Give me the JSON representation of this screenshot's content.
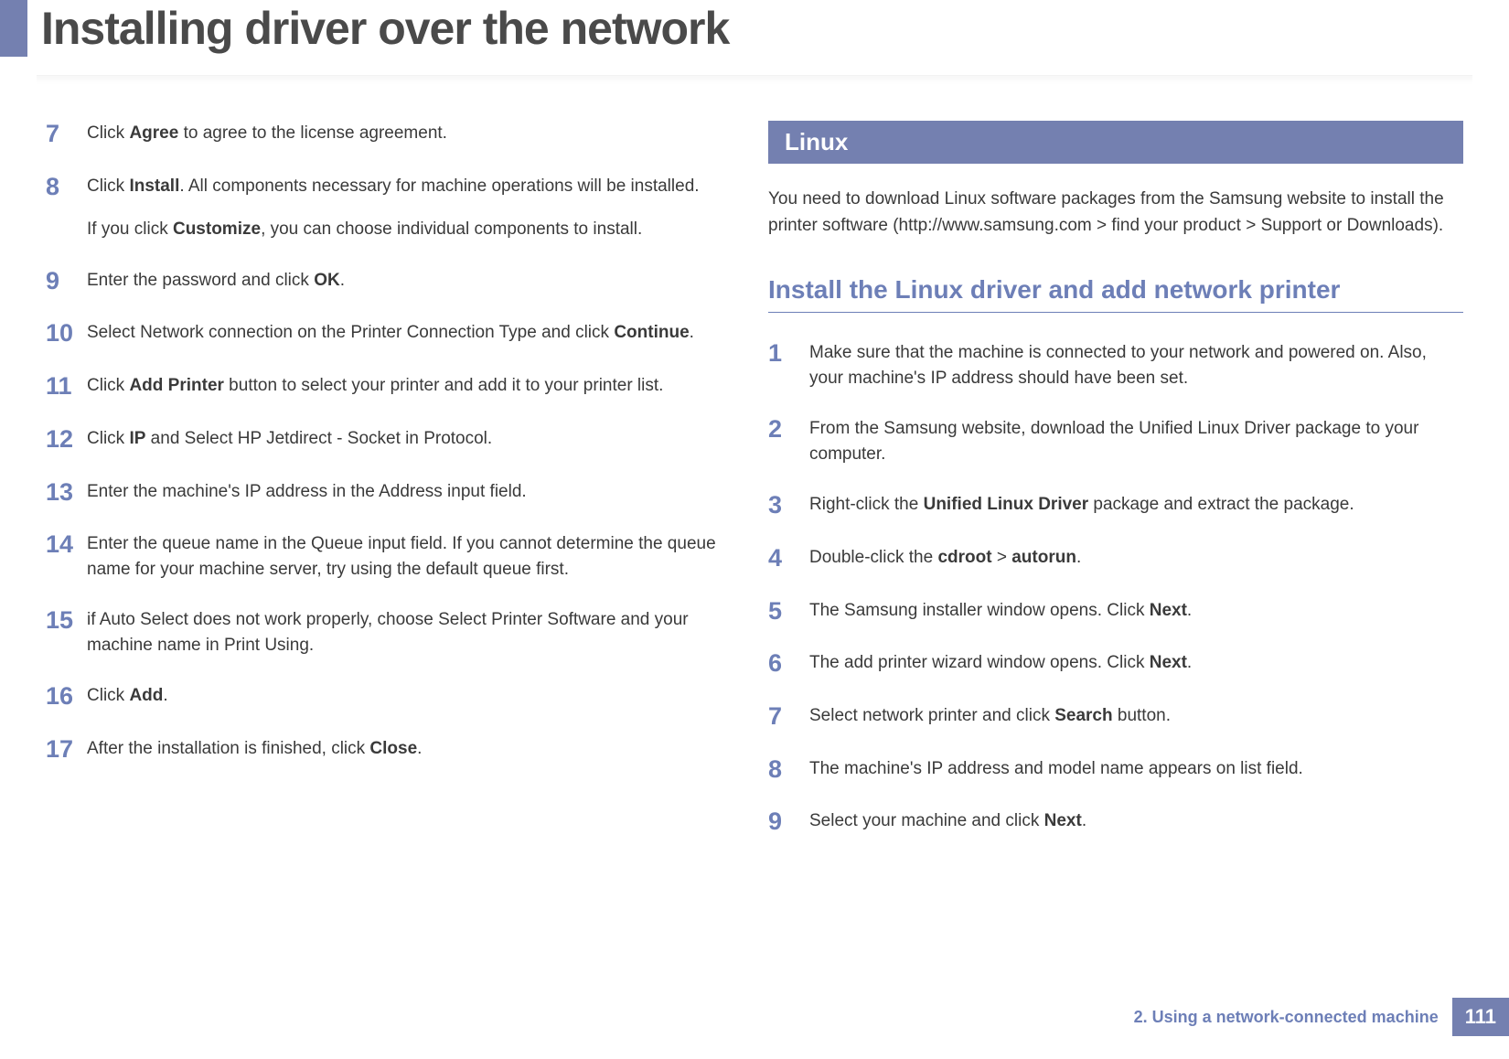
{
  "title": "Installing driver over the network",
  "left_column": {
    "steps": [
      {
        "num": "7",
        "segments": [
          {
            "text": "Click ",
            "bold": false
          },
          {
            "text": "Agree",
            "bold": true
          },
          {
            "text": " to agree to the license agreement.",
            "bold": false
          }
        ]
      },
      {
        "num": "8",
        "segments": [
          {
            "text": "Click ",
            "bold": false
          },
          {
            "text": "Install",
            "bold": true
          },
          {
            "text": ". All components necessary for machine operations will be installed.",
            "bold": false
          }
        ],
        "extra_segments": [
          {
            "text": "If you click ",
            "bold": false
          },
          {
            "text": "Customize",
            "bold": true
          },
          {
            "text": ", you can choose individual components to install.",
            "bold": false
          }
        ]
      },
      {
        "num": "9",
        "segments": [
          {
            "text": "Enter the password and click ",
            "bold": false
          },
          {
            "text": "OK",
            "bold": true
          },
          {
            "text": ".",
            "bold": false
          }
        ]
      },
      {
        "num": "10",
        "segments": [
          {
            "text": "Select Network connection on the Printer Connection Type and click ",
            "bold": false
          },
          {
            "text": "Continue",
            "bold": true
          },
          {
            "text": ".",
            "bold": false
          }
        ]
      },
      {
        "num": "11",
        "segments": [
          {
            "text": " Click ",
            "bold": false
          },
          {
            "text": "Add Printer",
            "bold": true
          },
          {
            "text": " button to select your printer and add it to your printer list.",
            "bold": false
          }
        ]
      },
      {
        "num": "12",
        "segments": [
          {
            "text": "Click ",
            "bold": false
          },
          {
            "text": "IP",
            "bold": true
          },
          {
            "text": " and Select HP Jetdirect - Socket in Protocol.",
            "bold": false
          }
        ]
      },
      {
        "num": "13",
        "segments": [
          {
            "text": "Enter the machine's IP address in the Address input field.",
            "bold": false
          }
        ]
      },
      {
        "num": "14",
        "segments": [
          {
            "text": "Enter the queue name in the Queue input field. If you cannot determine the queue name for your machine server, try using the default queue first.",
            "bold": false
          }
        ]
      },
      {
        "num": "15",
        "segments": [
          {
            "text": "if Auto Select does not work properly, choose Select Printer Software and your machine name in Print Using.",
            "bold": false
          }
        ]
      },
      {
        "num": "16",
        "segments": [
          {
            "text": "Click ",
            "bold": false
          },
          {
            "text": "Add",
            "bold": true
          },
          {
            "text": ".",
            "bold": false
          }
        ]
      },
      {
        "num": "17",
        "segments": [
          {
            "text": "After the installation is finished, click ",
            "bold": false
          },
          {
            "text": "Close",
            "bold": true
          },
          {
            "text": ".",
            "bold": false
          }
        ]
      }
    ]
  },
  "right_column": {
    "section_title": "Linux",
    "section_intro": "You need to download Linux software packages from the Samsung website to install the printer software (http://www.samsung.com > find your product > Support or Downloads).",
    "subsection_title": "Install the Linux driver and add network printer",
    "steps": [
      {
        "num": "1",
        "segments": [
          {
            "text": "Make sure that the machine is connected to your network and powered on. Also, your machine's IP address should have been set.",
            "bold": false
          }
        ]
      },
      {
        "num": "2",
        "segments": [
          {
            "text": "From the Samsung website, download the Unified Linux Driver package to your computer.",
            "bold": false
          }
        ]
      },
      {
        "num": "3",
        "segments": [
          {
            "text": "Right-click the ",
            "bold": false
          },
          {
            "text": "Unified Linux Driver",
            "bold": true
          },
          {
            "text": " package and extract the package.",
            "bold": false
          }
        ]
      },
      {
        "num": "4",
        "segments": [
          {
            "text": "Double-click the ",
            "bold": false
          },
          {
            "text": "cdroot",
            "bold": true
          },
          {
            "text": " > ",
            "bold": false
          },
          {
            "text": "autorun",
            "bold": true
          },
          {
            "text": ".",
            "bold": false
          }
        ]
      },
      {
        "num": "5",
        "segments": [
          {
            "text": "The Samsung installer window opens. Click ",
            "bold": false
          },
          {
            "text": "Next",
            "bold": true
          },
          {
            "text": ".",
            "bold": false
          }
        ]
      },
      {
        "num": "6",
        "segments": [
          {
            "text": "The add printer wizard window opens. Click ",
            "bold": false
          },
          {
            "text": "Next",
            "bold": true
          },
          {
            "text": ".",
            "bold": false
          }
        ]
      },
      {
        "num": "7",
        "segments": [
          {
            "text": "Select network printer and click ",
            "bold": false
          },
          {
            "text": "Search",
            "bold": true
          },
          {
            "text": " button.",
            "bold": false
          }
        ]
      },
      {
        "num": "8",
        "segments": [
          {
            "text": "The machine's IP address and model name appears on list field.",
            "bold": false
          }
        ]
      },
      {
        "num": "9",
        "segments": [
          {
            "text": "Select your machine and click ",
            "bold": false
          },
          {
            "text": "Next",
            "bold": true
          },
          {
            "text": ".",
            "bold": false
          }
        ]
      }
    ]
  },
  "footer": {
    "chapter": "2.  Using a network-connected machine",
    "page": "111"
  }
}
